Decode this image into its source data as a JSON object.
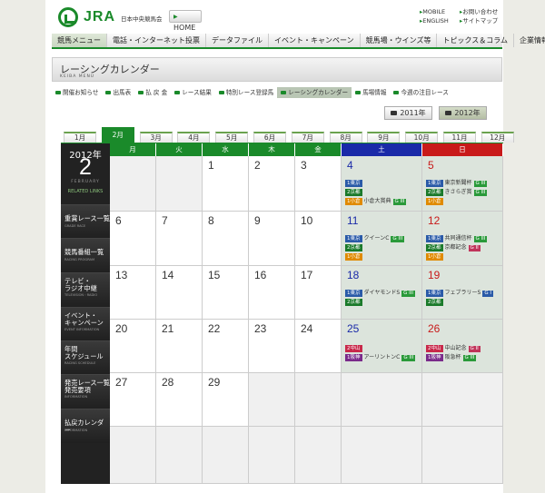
{
  "header": {
    "logo": "JRA",
    "logo_sub": "日本中央競馬会",
    "home": "HOME",
    "util": [
      "MOBILE",
      "お問い合わせ",
      "ENGLISH",
      "サイトマップ"
    ]
  },
  "gnav": [
    "競馬メニュー",
    "電話・インターネット投票",
    "データファイル",
    "イベント・キャンペーン",
    "競馬場・ウインズ等",
    "トピックス＆コラム",
    "企業情報"
  ],
  "title": {
    "main": "レーシングカレンダー",
    "sub": "KEIBA MENU"
  },
  "subnav": [
    "開催お知らせ",
    "出馬表",
    "払 戻 金",
    "レース結果",
    "特別レース登録馬",
    "レーシングカレンダー",
    "馬場情報",
    "今週の注目レース"
  ],
  "years": [
    "2011年",
    "2012年"
  ],
  "months": [
    "1月",
    "2月",
    "3月",
    "4月",
    "5月",
    "6月",
    "7月",
    "8月",
    "9月",
    "10月",
    "11月",
    "12月"
  ],
  "sidebar": {
    "year": "2012年",
    "month": "2",
    "month_name": "FEBRUARY",
    "related": "RELATED LINKS",
    "links": [
      {
        "t": "重賞レース一覧",
        "s": "GRADE RACE"
      },
      {
        "t": "競馬番組一覧",
        "s": "RACING PROGRAM"
      },
      {
        "t": "テレビ・\nラジオ中継",
        "s": "TELEVISION・RADIO"
      },
      {
        "t": "イベント・\nキャンペーン",
        "s": "EVENT INFORMATION"
      },
      {
        "t": "年間\nスケジュール",
        "s": "RACING SCHEDULE"
      },
      {
        "t": "発売レース一覧\n発売要項",
        "s": "INFORMATION"
      },
      {
        "t": "払戻カレンダー",
        "s": "INFORMATION"
      }
    ]
  },
  "weekdays": [
    "月",
    "火",
    "水",
    "木",
    "金",
    "土",
    "日"
  ],
  "weeks": [
    [
      {
        "d": ""
      },
      {
        "d": ""
      },
      {
        "d": "1"
      },
      {
        "d": "2"
      },
      {
        "d": "3"
      },
      {
        "d": "4",
        "ev": [
          {
            "v": "1東京",
            "vc": "#2a5aa8"
          },
          {
            "v": "2京都",
            "vc": "#1a7a2a"
          },
          {
            "v": "1小倉",
            "vc": "#e08a00",
            "n": "小倉大賞典",
            "g": "G III",
            "gc": "#2a9a3a"
          }
        ]
      },
      {
        "d": "5",
        "ev": [
          {
            "v": "1東京",
            "vc": "#2a5aa8",
            "n": "東京新聞杯",
            "g": "G III",
            "gc": "#2a9a3a"
          },
          {
            "v": "2京都",
            "vc": "#1a7a2a",
            "n": "きさらぎ賞",
            "g": "G III",
            "gc": "#2a9a3a"
          },
          {
            "v": "1小倉",
            "vc": "#e08a00"
          }
        ]
      }
    ],
    [
      {
        "d": "6"
      },
      {
        "d": "7"
      },
      {
        "d": "8"
      },
      {
        "d": "9"
      },
      {
        "d": "10"
      },
      {
        "d": "11",
        "ev": [
          {
            "v": "1東京",
            "vc": "#2a5aa8",
            "n": "クイーンC",
            "g": "G III",
            "gc": "#2a9a3a"
          },
          {
            "v": "2京都",
            "vc": "#1a7a2a"
          },
          {
            "v": "1小倉",
            "vc": "#e08a00"
          }
        ]
      },
      {
        "d": "12",
        "ev": [
          {
            "v": "1東京",
            "vc": "#2a5aa8",
            "n": "共同通信杯",
            "g": "G III",
            "gc": "#2a9a3a"
          },
          {
            "v": "2京都",
            "vc": "#1a7a2a",
            "n": "京都記念",
            "g": "G II",
            "gc": "#c0345a"
          },
          {
            "v": "1小倉",
            "vc": "#e08a00"
          }
        ]
      }
    ],
    [
      {
        "d": "13"
      },
      {
        "d": "14"
      },
      {
        "d": "15"
      },
      {
        "d": "16"
      },
      {
        "d": "17"
      },
      {
        "d": "18",
        "ev": [
          {
            "v": "1東京",
            "vc": "#2a5aa8",
            "n": "ダイヤモンドS",
            "g": "G III",
            "gc": "#2a9a3a"
          },
          {
            "v": "2京都",
            "vc": "#1a7a2a"
          }
        ]
      },
      {
        "d": "19",
        "ev": [
          {
            "v": "1東京",
            "vc": "#2a5aa8",
            "n": "フェブラリーS",
            "g": "G I",
            "gc": "#2a5aa8"
          },
          {
            "v": "2京都",
            "vc": "#1a7a2a"
          }
        ]
      }
    ],
    [
      {
        "d": "20"
      },
      {
        "d": "21"
      },
      {
        "d": "22"
      },
      {
        "d": "23"
      },
      {
        "d": "24"
      },
      {
        "d": "25",
        "ev": [
          {
            "v": "2中山",
            "vc": "#c8284a"
          },
          {
            "v": "1阪神",
            "vc": "#7a2a8a",
            "n": "アーリントンC",
            "g": "G III",
            "gc": "#2a9a3a"
          }
        ]
      },
      {
        "d": "26",
        "ev": [
          {
            "v": "2中山",
            "vc": "#c8284a",
            "n": "中山記念",
            "g": "G II",
            "gc": "#c0345a"
          },
          {
            "v": "1阪神",
            "vc": "#7a2a8a",
            "n": "阪急杯",
            "g": "G III",
            "gc": "#2a9a3a"
          }
        ]
      }
    ],
    [
      {
        "d": "27"
      },
      {
        "d": "28"
      },
      {
        "d": "29"
      },
      {
        "d": ""
      },
      {
        "d": ""
      },
      {
        "d": ""
      },
      {
        "d": ""
      }
    ],
    [
      {
        "d": ""
      },
      {
        "d": ""
      },
      {
        "d": ""
      },
      {
        "d": ""
      },
      {
        "d": ""
      },
      {
        "d": ""
      },
      {
        "d": ""
      }
    ]
  ],
  "colors": {
    "accent": "#1a8a2a",
    "saturday": "#1a2aa8",
    "sunday": "#c81a1a",
    "weekend_bg": "#dce4dc"
  }
}
